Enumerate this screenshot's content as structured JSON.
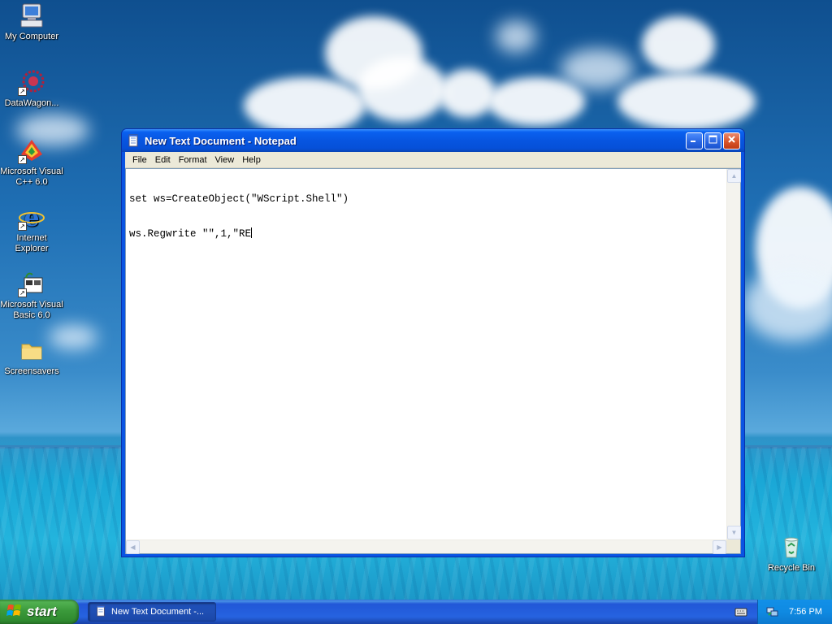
{
  "desktop": {
    "icons": [
      {
        "label": "My Computer",
        "icon": "my-computer-icon"
      },
      {
        "label": "DataWagon...",
        "icon": "datawagon-icon"
      },
      {
        "label": "Microsoft Visual C++ 6.0",
        "icon": "visual-cpp-icon"
      },
      {
        "label": "Internet Explorer",
        "icon": "internet-explorer-icon"
      },
      {
        "label": "Microsoft Visual Basic 6.0",
        "icon": "visual-basic-icon"
      },
      {
        "label": "Screensavers",
        "icon": "folder-icon"
      },
      {
        "label": "Recycle Bin",
        "icon": "recycle-bin-icon"
      }
    ]
  },
  "window": {
    "title": "New Text Document - Notepad",
    "controls": {
      "minimize": "minimize-icon",
      "maximize": "maximize-icon",
      "close": "close-icon"
    },
    "menu": [
      "File",
      "Edit",
      "Format",
      "View",
      "Help"
    ],
    "content": {
      "line1": "set ws=CreateObject(\"WScript.Shell\")",
      "line2": "ws.Regwrite \"\",1,\"RE"
    }
  },
  "taskbar": {
    "start_label": "start",
    "task_button": "New Text Document -...",
    "clock": "7:56 PM"
  },
  "colors": {
    "titlebar": "#0755e0",
    "taskbar": "#2663e0",
    "start_green": "#3b9a3b",
    "tray": "#0f8ae2",
    "menubar": "#ece9d8"
  }
}
